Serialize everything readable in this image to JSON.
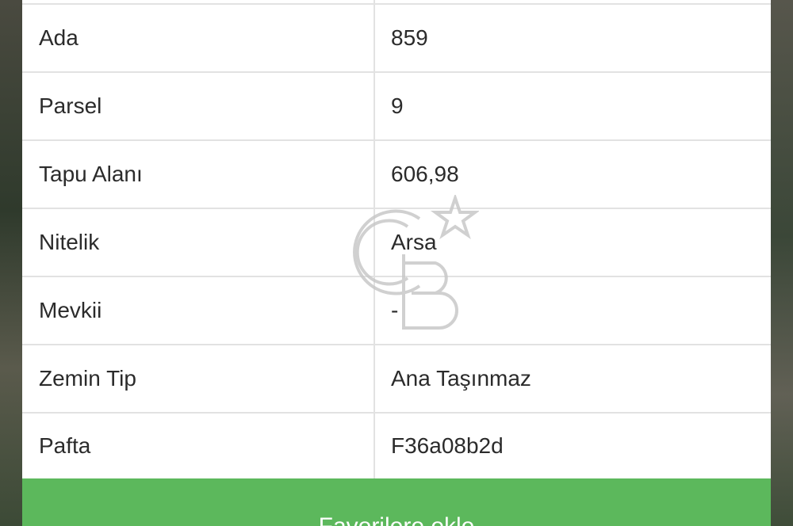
{
  "table": {
    "rows": [
      {
        "label": "Ada",
        "value": "859"
      },
      {
        "label": "Parsel",
        "value": "9"
      },
      {
        "label": "Tapu Alanı",
        "value": "606,98"
      },
      {
        "label": "Nitelik",
        "value": "Arsa"
      },
      {
        "label": "Mevkii",
        "value": "-"
      },
      {
        "label": "Zemin Tip",
        "value": "Ana Taşınmaz"
      },
      {
        "label": "Pafta",
        "value": "F36a08b2d"
      }
    ]
  },
  "action": {
    "favorite_label": "Favorilere ekle"
  },
  "colors": {
    "button_green": "#5cb85c",
    "border": "#e2e2e2",
    "text": "#2b2b2b"
  },
  "watermark": {
    "icon": "coldwell-banker-logo-icon"
  }
}
